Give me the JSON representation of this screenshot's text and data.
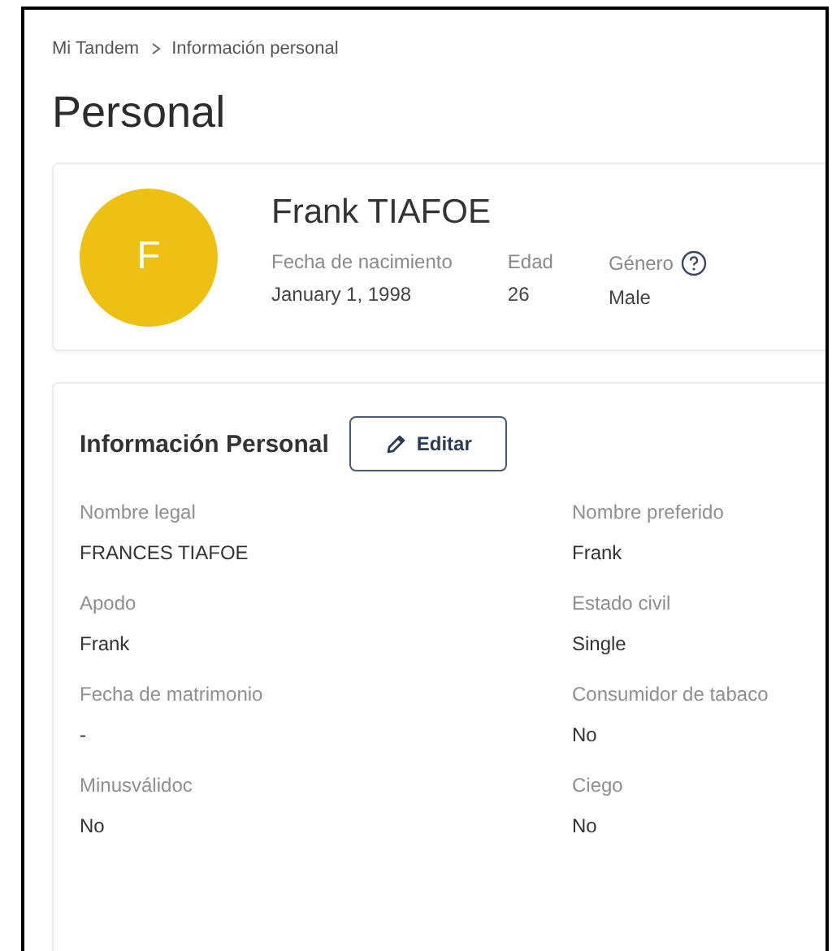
{
  "breadcrumb": [
    {
      "label": "Mi Tandem"
    },
    {
      "label": "Información personal"
    }
  ],
  "title": "Personal",
  "profile": {
    "initial": "F",
    "name": "Frank TIAFOE",
    "facts": [
      {
        "label": "Fecha de nacimiento",
        "value": "January 1, 1998",
        "help": false
      },
      {
        "label": "Edad",
        "value": "26",
        "help": false
      },
      {
        "label": "Género",
        "value": "Male",
        "help": true
      }
    ]
  },
  "personal_info": {
    "title": "Información Personal",
    "edit_button": "Editar",
    "fields": [
      {
        "label": "Nombre legal",
        "value": "FRANCES TIAFOE"
      },
      {
        "label": "Nombre preferido",
        "value": "Frank"
      },
      {
        "label": "Apodo",
        "value": "Frank"
      },
      {
        "label": "Estado civil",
        "value": "Single"
      },
      {
        "label": "Fecha de matrimonio",
        "value": "-"
      },
      {
        "label": "Consumidor de tabaco",
        "value": "No"
      },
      {
        "label": "Minusválidoc",
        "value": "No"
      },
      {
        "label": "Ciego",
        "value": "No"
      }
    ]
  }
}
